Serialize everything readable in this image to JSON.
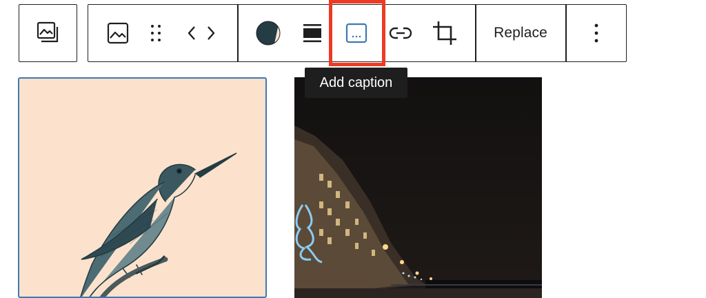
{
  "toolbar": {
    "replace_label": "Replace",
    "items": [
      {
        "name": "gallery-icon",
        "label": "Gallery"
      },
      {
        "name": "image-icon",
        "label": "Image"
      },
      {
        "name": "drag-handle-icon",
        "label": "Drag"
      },
      {
        "name": "move-arrows-icon",
        "label": "Move"
      },
      {
        "name": "duotone-icon",
        "label": "Apply duotone filter"
      },
      {
        "name": "align-icon",
        "label": "Align"
      },
      {
        "name": "caption-icon",
        "label": "Add caption"
      },
      {
        "name": "link-icon",
        "label": "Link"
      },
      {
        "name": "crop-icon",
        "label": "Crop"
      },
      {
        "name": "more-options-icon",
        "label": "Options"
      }
    ],
    "highlight_color": "#ec3b24",
    "caption_icon_color": "#3c78b4"
  },
  "tooltip": {
    "text": "Add caption"
  },
  "images": [
    {
      "name": "hummingbird-engraving",
      "selected": true,
      "background": "#fce2cc"
    },
    {
      "name": "night-waterfront",
      "selected": false,
      "background": "#141110"
    }
  ]
}
